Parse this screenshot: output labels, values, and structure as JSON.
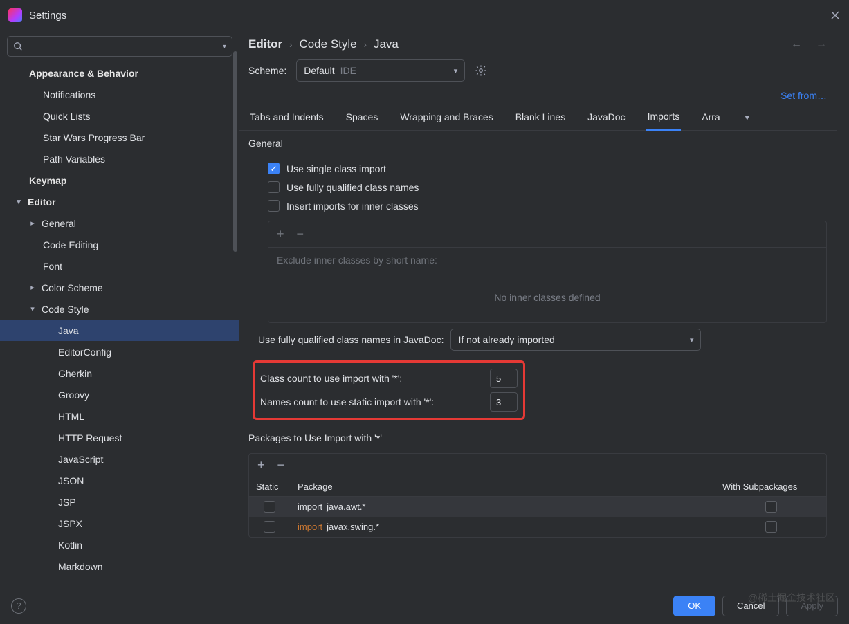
{
  "window": {
    "title": "Settings"
  },
  "search": {
    "placeholder": ""
  },
  "sidebar": {
    "items": [
      {
        "label": "Appearance & Behavior",
        "type": "head",
        "indent": 0
      },
      {
        "label": "Notifications",
        "type": "item",
        "indent": 1
      },
      {
        "label": "Quick Lists",
        "type": "item",
        "indent": 1
      },
      {
        "label": "Star Wars Progress Bar",
        "type": "item",
        "indent": 1
      },
      {
        "label": "Path Variables",
        "type": "item",
        "indent": 1
      },
      {
        "label": "Keymap",
        "type": "head",
        "indent": 0
      },
      {
        "label": "Editor",
        "type": "head",
        "indent": 0,
        "expanded": true
      },
      {
        "label": "General",
        "type": "item",
        "indent": 1,
        "hasChildren": true
      },
      {
        "label": "Code Editing",
        "type": "item",
        "indent": 1
      },
      {
        "label": "Font",
        "type": "item",
        "indent": 1
      },
      {
        "label": "Color Scheme",
        "type": "item",
        "indent": 1,
        "hasChildren": true
      },
      {
        "label": "Code Style",
        "type": "item",
        "indent": 1,
        "hasChildren": true,
        "expanded": true
      },
      {
        "label": "Java",
        "type": "item",
        "indent": 2,
        "selected": true
      },
      {
        "label": "EditorConfig",
        "type": "item",
        "indent": 2
      },
      {
        "label": "Gherkin",
        "type": "item",
        "indent": 2
      },
      {
        "label": "Groovy",
        "type": "item",
        "indent": 2
      },
      {
        "label": "HTML",
        "type": "item",
        "indent": 2
      },
      {
        "label": "HTTP Request",
        "type": "item",
        "indent": 2
      },
      {
        "label": "JavaScript",
        "type": "item",
        "indent": 2
      },
      {
        "label": "JSON",
        "type": "item",
        "indent": 2
      },
      {
        "label": "JSP",
        "type": "item",
        "indent": 2
      },
      {
        "label": "JSPX",
        "type": "item",
        "indent": 2
      },
      {
        "label": "Kotlin",
        "type": "item",
        "indent": 2
      },
      {
        "label": "Markdown",
        "type": "item",
        "indent": 2
      }
    ]
  },
  "breadcrumb": [
    "Editor",
    "Code Style",
    "Java"
  ],
  "scheme": {
    "label": "Scheme:",
    "value": "Default",
    "suffix": "IDE"
  },
  "setfrom": "Set from…",
  "tabs": [
    "Tabs and Indents",
    "Spaces",
    "Wrapping and Braces",
    "Blank Lines",
    "JavaDoc",
    "Imports",
    "Arra"
  ],
  "active_tab": 5,
  "general": {
    "title": "General",
    "checks": [
      {
        "label": "Use single class import",
        "checked": true
      },
      {
        "label": "Use fully qualified class names",
        "checked": false
      },
      {
        "label": "Insert imports for inner classes",
        "checked": false
      }
    ],
    "exclude_hint": "Exclude inner classes by short name:",
    "exclude_empty": "No inner classes defined"
  },
  "javadoc_fqn": {
    "label": "Use fully qualified class names in JavaDoc:",
    "value": "If not already imported"
  },
  "counts": {
    "class_label": "Class count to use import with '*':",
    "class_value": "5",
    "names_label": "Names count to use static import with '*':",
    "names_value": "3"
  },
  "packages": {
    "title": "Packages to Use Import with '*'",
    "headers": {
      "static": "Static",
      "package": "Package",
      "sub": "With Subpackages"
    },
    "rows": [
      {
        "static": false,
        "prefix": "import ",
        "pkg": "java.awt.*",
        "sub": false,
        "hl": false,
        "sel": true
      },
      {
        "static": false,
        "prefix": "import ",
        "pkg": "javax.swing.*",
        "sub": false,
        "hl": true,
        "sel": false
      }
    ]
  },
  "footer": {
    "ok": "OK",
    "cancel": "Cancel",
    "apply": "Apply"
  },
  "watermark": "@稀土掘金技术社区"
}
